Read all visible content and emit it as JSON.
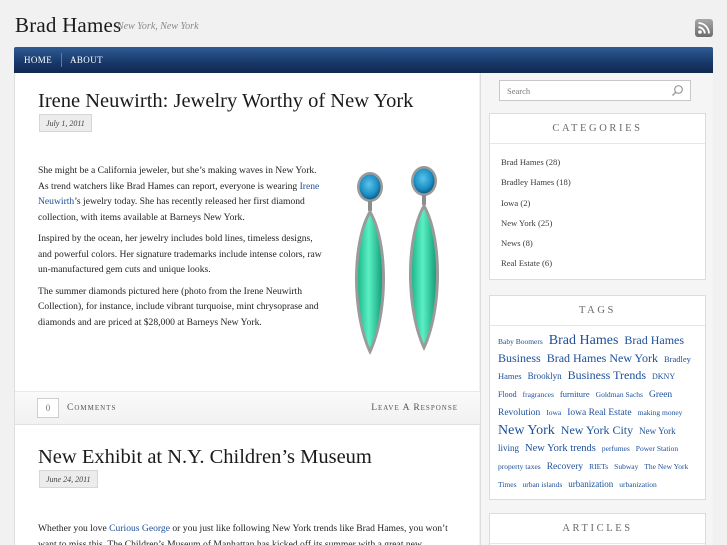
{
  "site": {
    "title": "Brad Hames",
    "tagline": "New York, New York"
  },
  "nav": {
    "home": "HOME",
    "about": "ABOUT"
  },
  "posts": [
    {
      "title": "Irene Neuwirth: Jewelry Worthy of New York",
      "date": "July 1, 2011",
      "p1_before": "She might be a California jeweler, but she’s making waves in New York. As trend watchers like Brad Hames can report, everyone is wearing ",
      "p1_link": "Irene Neuwirth",
      "p1_after": "’s jewelry today. She has recently released her first diamond collection, with items available at Barneys New York.",
      "p2": "Inspired by the ocean, her jewelry includes bold lines, timeless designs, and powerful colors.  Her signature trademarks include intense colors, raw un-manufactured gem cuts and unique looks.",
      "p3": "The summer diamonds pictured here (photo from the Irene Neuwirth Collection), for instance, include vibrant turquoise, mint chrysoprase and diamonds and are priced at $28,000 at Barneys New York.",
      "comment_count": "0",
      "comments_label": "Comments",
      "respond_label": "Leave A Response"
    },
    {
      "title": "New Exhibit at N.Y. Children’s Museum",
      "date": "June 24, 2011",
      "p1_before": "Whether you love ",
      "p1_link": "Curious George",
      "p1_after": " or you just like following New York trends like Brad Hames, you won’t want to miss this. The Children’s Museum of Manhattan has kicked off its summer with a great new"
    }
  ],
  "sidebar": {
    "search_placeholder": "Search",
    "categories_title": "CATEGORIES",
    "categories": [
      "Brad Hames (28)",
      "Bradley Hames (18)",
      "Iowa (2)",
      "New York (25)",
      "News (8)",
      "Real Estate (6)"
    ],
    "tags_title": "TAGS",
    "tags": [
      {
        "text": "Baby Boomers",
        "size": 7.5
      },
      {
        "text": "Brad Hames",
        "size": 14
      },
      {
        "text": "Brad Hames Business",
        "size": 12
      },
      {
        "text": "Brad Hames New York",
        "size": 12
      },
      {
        "text": "Bradley Hames",
        "size": 8.5
      },
      {
        "text": "Brooklyn",
        "size": 9
      },
      {
        "text": "Business Trends",
        "size": 12
      },
      {
        "text": "DKNY",
        "size": 8
      },
      {
        "text": "Flood",
        "size": 8
      },
      {
        "text": "fragrances",
        "size": 7.5
      },
      {
        "text": "furniture",
        "size": 8.5
      },
      {
        "text": "Goldman Sachs",
        "size": 7.5
      },
      {
        "text": "Green Revolution",
        "size": 9.5
      },
      {
        "text": "Iowa",
        "size": 7.5
      },
      {
        "text": "Iowa Real Estate",
        "size": 9.5
      },
      {
        "text": "making money",
        "size": 7.5
      },
      {
        "text": "New York",
        "size": 14
      },
      {
        "text": "New York City",
        "size": 12
      },
      {
        "text": "New York living",
        "size": 9
      },
      {
        "text": "New York trends",
        "size": 10.5
      },
      {
        "text": "perfumes",
        "size": 7.5
      },
      {
        "text": "Power Station",
        "size": 7.5
      },
      {
        "text": "property taxes",
        "size": 7.5
      },
      {
        "text": "Recovery",
        "size": 9.5
      },
      {
        "text": "RIETs",
        "size": 7.5
      },
      {
        "text": "Subway",
        "size": 7.5
      },
      {
        "text": "The New York Times",
        "size": 7.5
      },
      {
        "text": "urban islands",
        "size": 7.5
      },
      {
        "text": "urbanization",
        "size": 9
      },
      {
        "text": "urbanization",
        "size": 7.5
      }
    ],
    "articles_title": "ARTICLES"
  },
  "colors": {
    "nav": "#18386a",
    "link": "#1d4f9a",
    "gem_turquoise": "#1b8fc4",
    "gem_mint": "#2fd3a4"
  }
}
